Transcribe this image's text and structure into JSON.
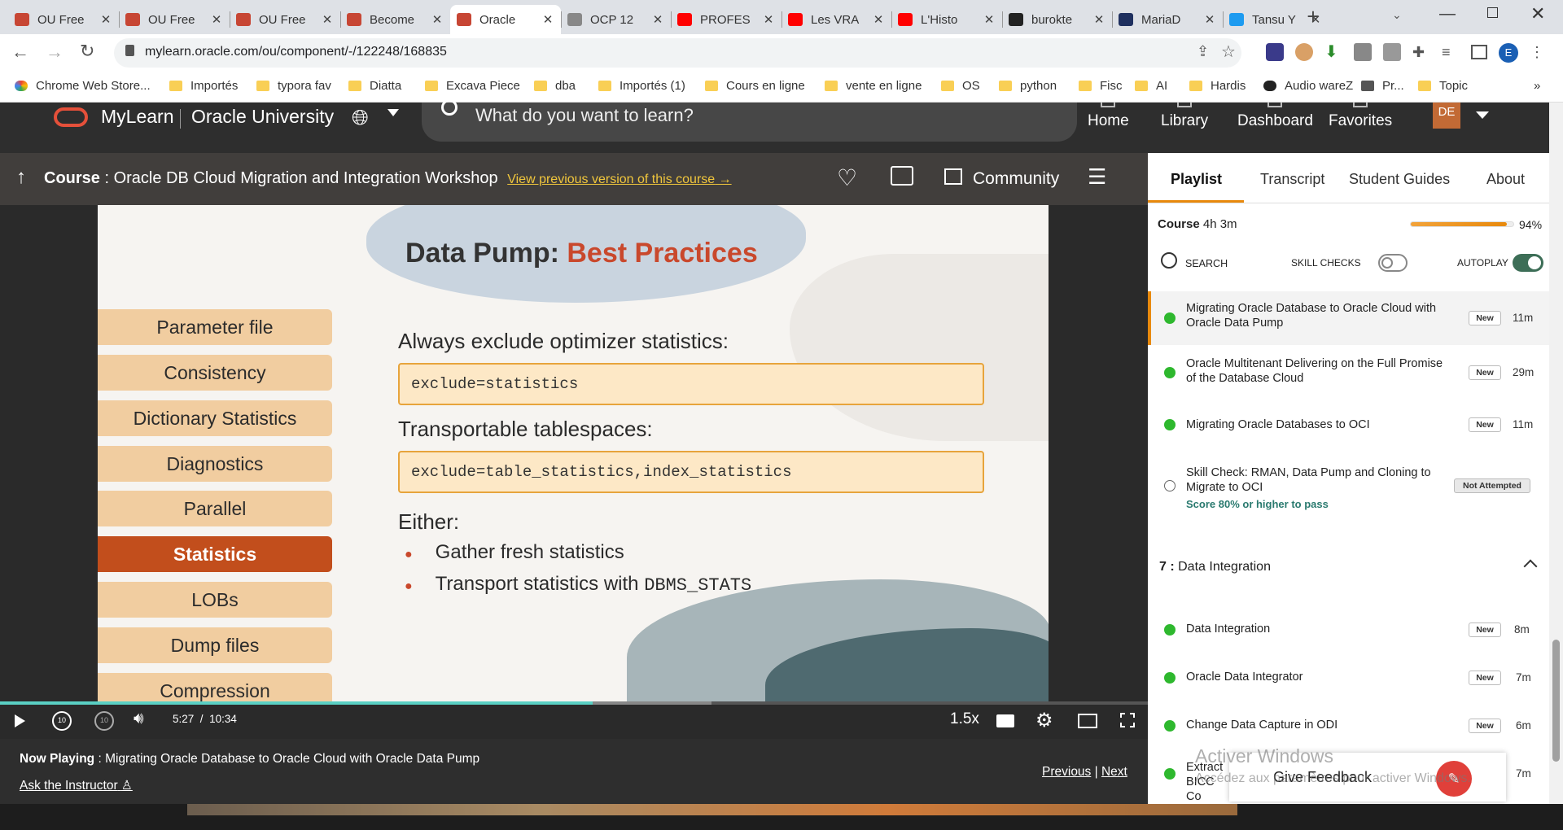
{
  "browser": {
    "tabs": [
      {
        "title": "OU Free",
        "icon": "oracle-icon",
        "active": false
      },
      {
        "title": "OU Free",
        "icon": "oracle-icon",
        "active": false
      },
      {
        "title": "OU Free",
        "icon": "oracle-icon",
        "active": false
      },
      {
        "title": "Become",
        "icon": "oracle-icon",
        "active": false
      },
      {
        "title": "Oracle",
        "icon": "oracle-icon",
        "active": true
      },
      {
        "title": "OCP 12",
        "icon": "database-icon",
        "active": false
      },
      {
        "title": "PROFES",
        "icon": "youtube-icon",
        "active": false
      },
      {
        "title": "Les VRA",
        "icon": "youtube-icon",
        "active": false
      },
      {
        "title": "L'Histo",
        "icon": "youtube-icon",
        "active": false
      },
      {
        "title": "burokte",
        "icon": "github-icon",
        "active": false
      },
      {
        "title": "MariaD",
        "icon": "mariadb-icon",
        "active": false
      },
      {
        "title": "Tansu Y",
        "icon": "twitter-icon",
        "active": false
      }
    ],
    "url": "mylearn.oracle.com/ou/component/-/122248/168835",
    "profile_initial": "E",
    "bookmarks": [
      "Chrome Web Store...",
      "Importés",
      "typora fav",
      "Diatta",
      "Excava Piece",
      "dba",
      "Importés (1)",
      "Cours en ligne",
      "vente en ligne",
      "OS",
      "python",
      "Fisc",
      "AI",
      "Hardis",
      "Audio wareZ",
      "Pr...",
      "Topic"
    ],
    "more_bookmarks": "»"
  },
  "site": {
    "brand": "MyLearn",
    "org": "Oracle University",
    "search_placeholder": "What do you want to learn?",
    "nav": [
      "Home",
      "Library",
      "Dashboard",
      "Favorites"
    ],
    "user_initials": "DE"
  },
  "course": {
    "label": "Course",
    "title": "Oracle DB Cloud Migration and Integration Workshop",
    "prev_version_link": "View previous version of this course",
    "community": "Community"
  },
  "slide": {
    "title_part1": "Data Pump: ",
    "title_part2": "Best Practices",
    "menu": [
      "Parameter file",
      "Consistency",
      "Dictionary Statistics",
      "Diagnostics",
      "Parallel",
      "Statistics",
      "LOBs",
      "Dump files",
      "Compression"
    ],
    "selected_menu_index": 5,
    "heading1": "Always exclude optimizer statistics:",
    "code1": "exclude=statistics",
    "heading2": "Transportable tablespaces:",
    "code2": "exclude=table_statistics,index_statistics",
    "heading3": "Either:",
    "bullet1": "Gather fresh statistics",
    "bullet2_text": "Transport statistics with ",
    "bullet2_code": "DBMS_STATS"
  },
  "player": {
    "current_time": "5:27",
    "duration": "10:34",
    "time_sep": "/",
    "speed": "1.5x",
    "progress": 0.516,
    "buffered": 0.62
  },
  "now_playing": {
    "label": "Now Playing",
    "title": "Migrating Oracle Database to Oracle Cloud with Oracle Data Pump",
    "ask": "Ask the Instructor",
    "previous": "Previous",
    "next": "Next",
    "separator": "|"
  },
  "panel": {
    "tabs": [
      "Playlist",
      "Transcript",
      "Student Guides",
      "About"
    ],
    "course_label": "Course",
    "course_duration": "4h 3m",
    "course_progress_text": "94%",
    "course_progress": 0.94,
    "search_label": "SEARCH",
    "skill_checks_label": "SKILL CHECKS",
    "autoplay_label": "AUTOPLAY",
    "items": [
      {
        "title": "Migrating Oracle Database to Oracle Cloud with Oracle Data Pump",
        "badge": "New",
        "duration": "11m",
        "status": "done",
        "current": true
      },
      {
        "title": "Oracle Multitenant Delivering on the Full Promise of the Database Cloud",
        "badge": "New",
        "duration": "29m",
        "status": "done",
        "current": false
      },
      {
        "title": "Migrating Oracle Databases to OCI",
        "badge": "New",
        "duration": "11m",
        "status": "done",
        "current": false
      },
      {
        "title": "Skill Check: RMAN, Data Pump and Cloning to Migrate to OCI",
        "subtitle": "Score 80% or higher to pass",
        "badge": "Not Attempted",
        "duration": "",
        "status": "open",
        "current": false
      }
    ],
    "section_number": "7 :",
    "section_title": "Data Integration",
    "section_items": [
      {
        "title": "Data Integration",
        "badge": "New",
        "duration": "8m"
      },
      {
        "title": "Oracle Data Integrator",
        "badge": "New",
        "duration": "7m"
      },
      {
        "title": "Change Data Capture in ODI",
        "badge": "New",
        "duration": "6m"
      },
      {
        "title": "Extract BICC Co",
        "badge": "New",
        "duration": "7m"
      }
    ],
    "feedback": "Give Feedback"
  },
  "watermark": {
    "line1": "Activer Windows",
    "line2": "Accédez aux paramètres pour activer Windows."
  },
  "colors": {
    "oracle_red": "#c74634",
    "accent_orange": "#e8890c",
    "link_yellow": "#f0c63c",
    "success_green": "#2eb82e",
    "teal_progress": "#5ad0c4",
    "slide_highlight": "#c24e1c"
  }
}
